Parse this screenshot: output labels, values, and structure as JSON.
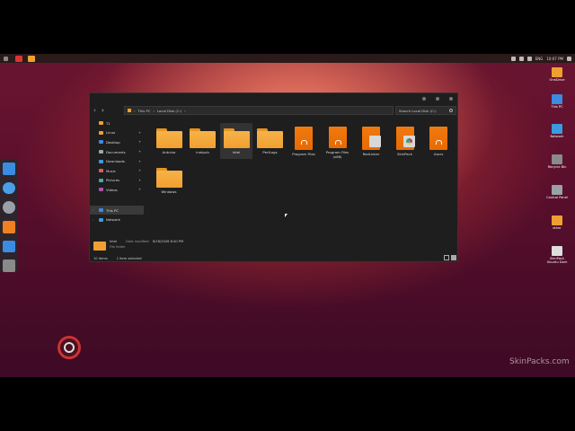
{
  "topbar": {
    "tray": {
      "language": "ENG",
      "time": "10:07 PM"
    }
  },
  "desktop_icons": [
    {
      "label": "OneDrive",
      "color": "#f0a030"
    },
    {
      "label": "This PC",
      "color": "#3b8be0"
    },
    {
      "label": "Network",
      "color": "#3b9be0"
    },
    {
      "label": "Recycle Bin",
      "color": "#8a8a8a"
    },
    {
      "label": "Control Panel",
      "color": "#9aa0a8"
    },
    {
      "label": "other",
      "color": "#f0a030"
    },
    {
      "label": "SkinPack Ubuntu Dark",
      "color": "#dddddd"
    }
  ],
  "watermark": "SkinPacks.com",
  "explorer": {
    "breadcrumb": [
      "This PC",
      "Local Disk (C:)"
    ],
    "search_placeholder": "Search Local Disk (C:)",
    "sidebar": [
      {
        "label": "T1",
        "icon": "folder-icon",
        "pinned": false
      },
      {
        "label": "Linux",
        "icon": "folder-icon",
        "pinned": true
      },
      {
        "label": "Desktop",
        "icon": "desktop-icon",
        "pinned": true
      },
      {
        "label": "Documents",
        "icon": "documents-icon",
        "pinned": true
      },
      {
        "label": "Downloads",
        "icon": "downloads-icon",
        "pinned": true
      },
      {
        "label": "Music",
        "icon": "music-icon",
        "pinned": true
      },
      {
        "label": "Pictures",
        "icon": "pictures-icon",
        "pinned": true
      },
      {
        "label": "Videos",
        "icon": "videos-icon",
        "pinned": true
      },
      {
        "label": "This PC",
        "icon": "computer-icon",
        "pinned": false
      },
      {
        "label": "Network",
        "icon": "network-icon",
        "pinned": false
      }
    ],
    "items": [
      {
        "name": "Arduino",
        "type": "folder"
      },
      {
        "name": "inetpub",
        "type": "folder"
      },
      {
        "name": "Intel",
        "type": "folder",
        "selected": true
      },
      {
        "name": "PerfLogs",
        "type": "folder"
      },
      {
        "name": "Program Files",
        "type": "pfolder"
      },
      {
        "name": "Program Files (x86)",
        "type": "pfolder"
      },
      {
        "name": "RedLinker",
        "type": "pfolder-card"
      },
      {
        "name": "SkinPack",
        "type": "pfolder-chrome"
      },
      {
        "name": "Users",
        "type": "pfolder"
      },
      {
        "name": "Windows",
        "type": "folder"
      }
    ],
    "details": {
      "name": "Intel",
      "type": "File folder",
      "date_label": "Date modified:",
      "date_value": "8/18/2026 8:40 PM"
    },
    "status": {
      "count": "10 items",
      "selection": "1 item selected"
    }
  }
}
